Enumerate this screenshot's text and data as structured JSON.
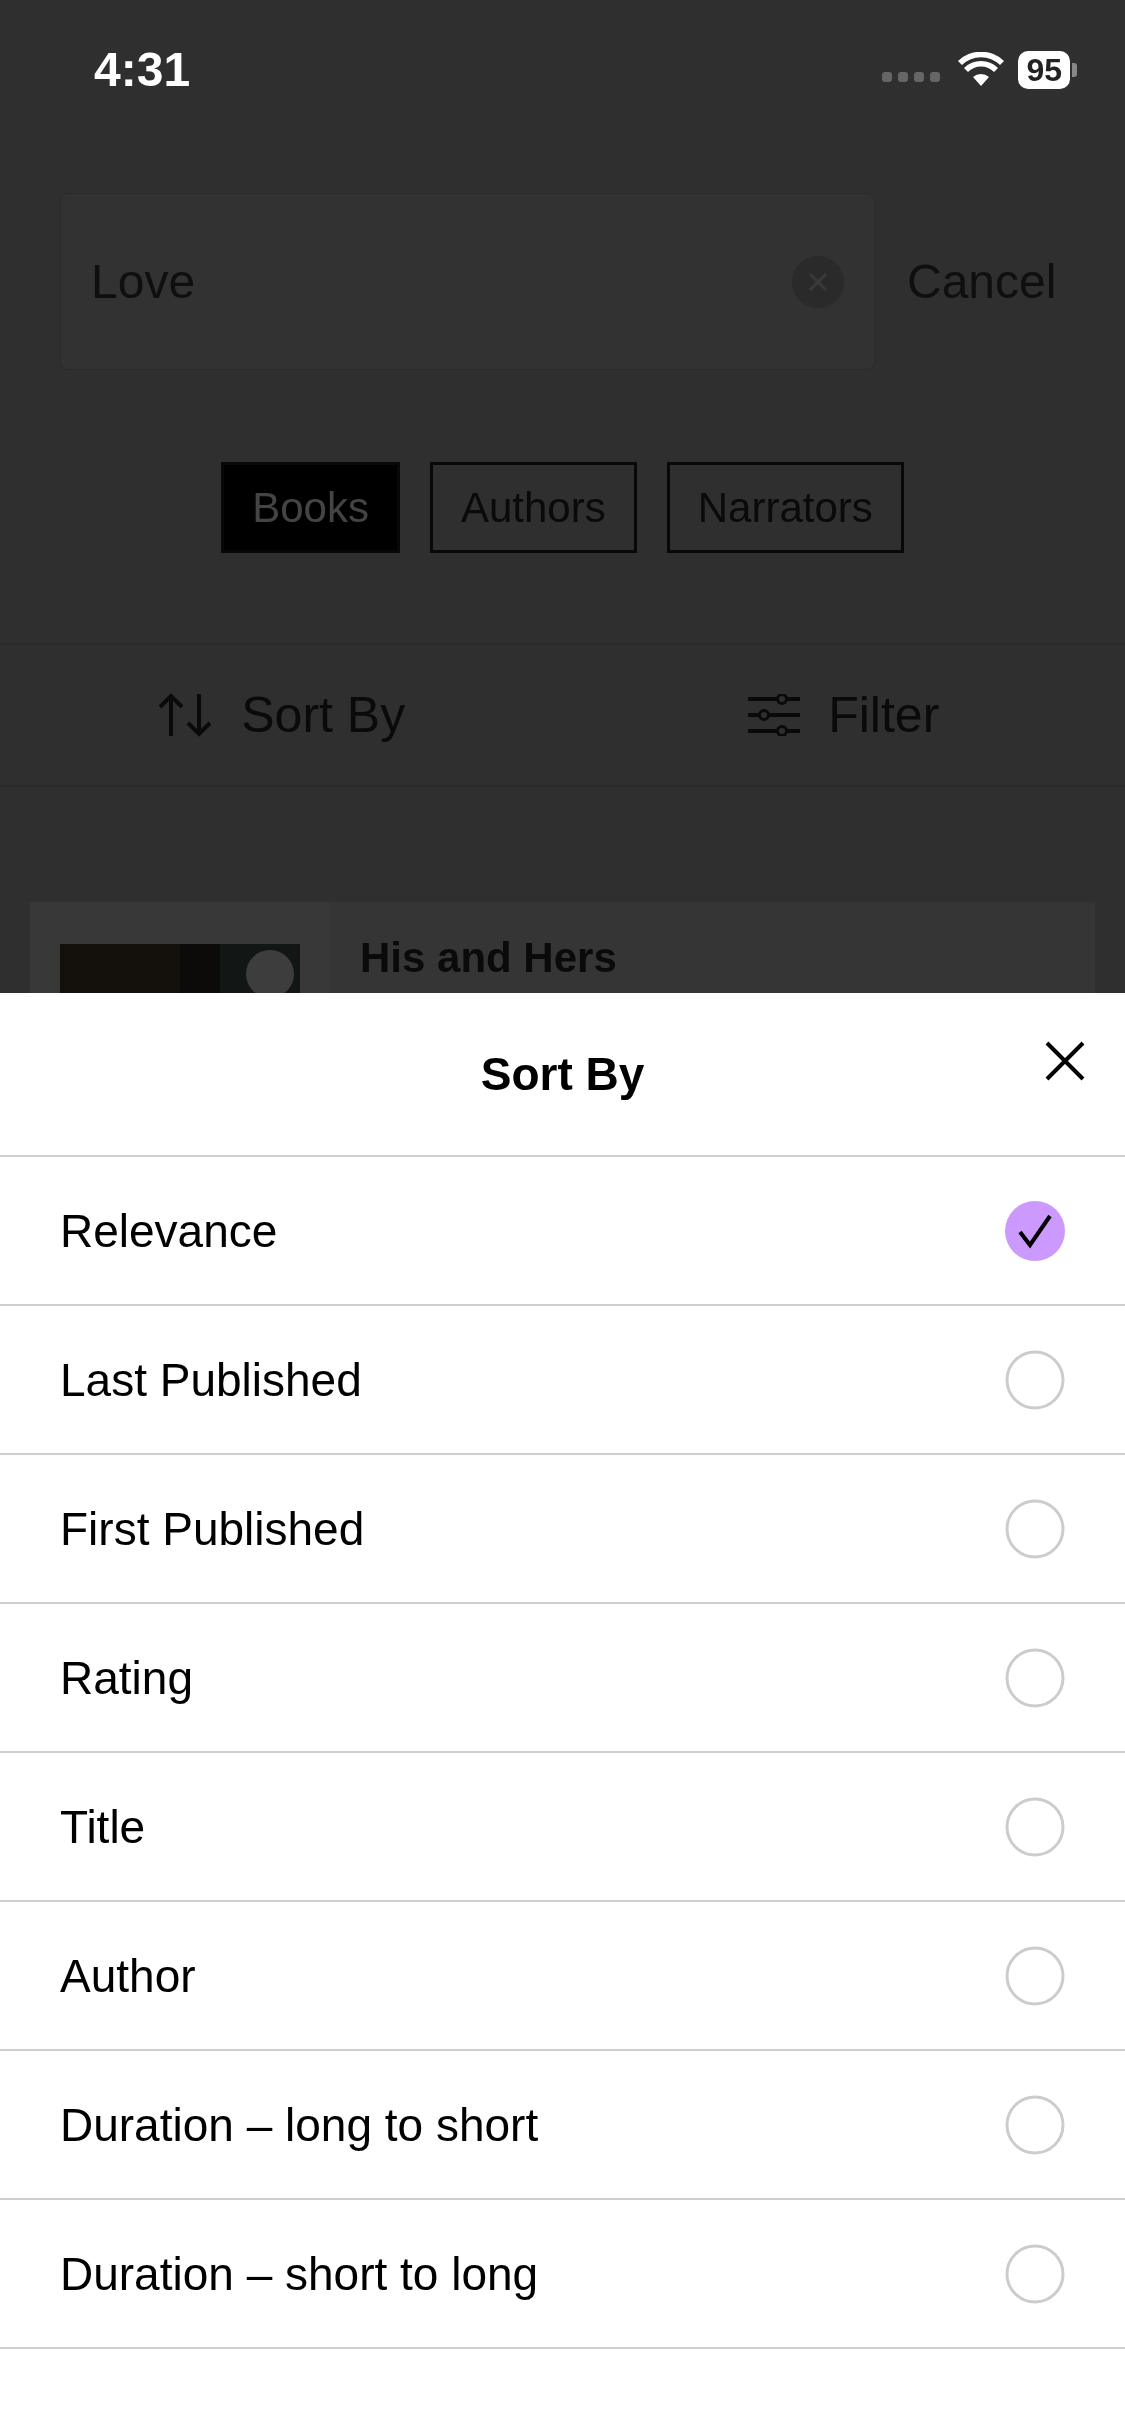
{
  "status_bar": {
    "time": "4:31",
    "battery": "95"
  },
  "search": {
    "value": "Love",
    "cancel": "Cancel"
  },
  "tabs": [
    {
      "label": "Books",
      "selected": true
    },
    {
      "label": "Authors",
      "selected": false
    },
    {
      "label": "Narrators",
      "selected": false
    }
  ],
  "toolbar": {
    "sort": "Sort By",
    "filter": "Filter"
  },
  "results": [
    {
      "title": "His and Hers"
    }
  ],
  "sheet": {
    "title": "Sort By",
    "options": [
      {
        "label": "Relevance",
        "selected": true
      },
      {
        "label": "Last Published",
        "selected": false
      },
      {
        "label": "First Published",
        "selected": false
      },
      {
        "label": "Rating",
        "selected": false
      },
      {
        "label": "Title",
        "selected": false
      },
      {
        "label": "Author",
        "selected": false
      },
      {
        "label": "Duration – long to short",
        "selected": false
      },
      {
        "label": "Duration – short to long",
        "selected": false
      }
    ]
  }
}
